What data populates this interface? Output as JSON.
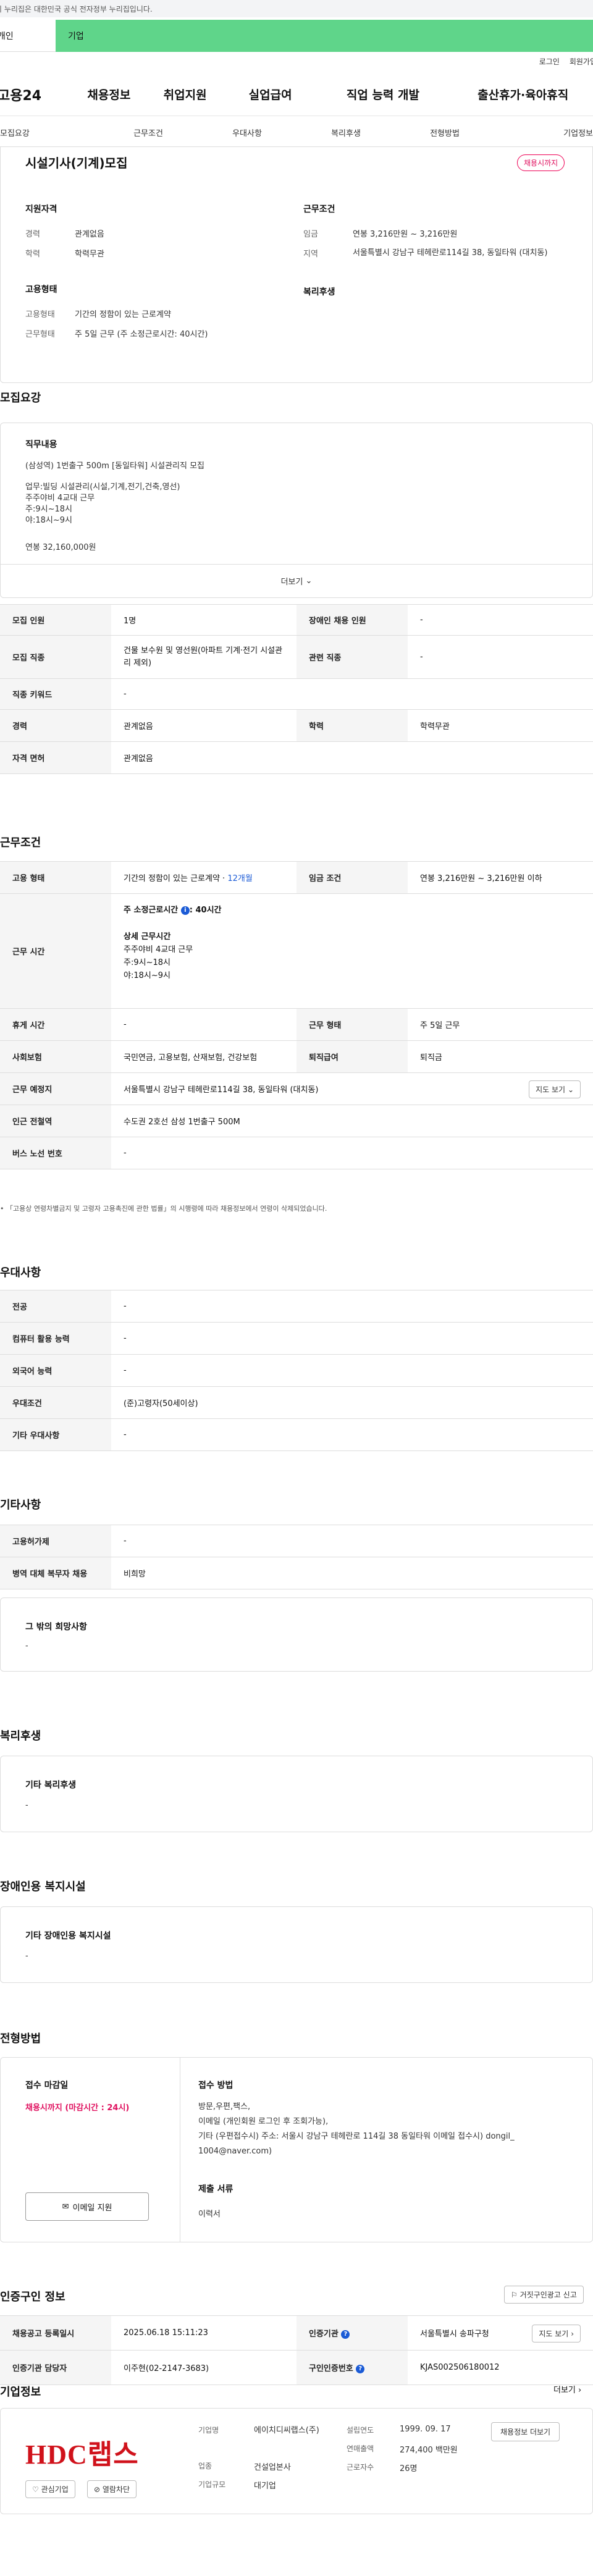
{
  "gov_bar": "이 누리집은 대한민국 공식 전자정부 누리집입니다.",
  "user_tabs": {
    "person": "개인",
    "corp": "기업"
  },
  "util": {
    "login": "로그인",
    "join": "회원가입"
  },
  "gnb": {
    "logo": "고용24",
    "menus": [
      "채용정보",
      "취업지원",
      "실업급여",
      "직업 능력 개발",
      "출산휴가·육아휴직"
    ]
  },
  "subtabs": [
    "모집요강",
    "근무조건",
    "우대사항",
    "복리후생",
    "전형방법",
    "기업정보"
  ],
  "summary": {
    "title": "시설기사(기계)모집",
    "deadline_badge": "채용시까지",
    "qual_title": "지원자격",
    "career_label": "경력",
    "career_value": "관계없음",
    "edu_label": "학력",
    "edu_value": "학력무관",
    "cond_title": "근무조건",
    "wage_label": "임금",
    "wage_value": "연봉 3,216만원 ~ 3,216만원",
    "region_label": "지역",
    "region_value": "서울특별시 강남구 테헤란로114길 38, 동일타워 (대치동)",
    "emp_title": "고용형태",
    "emptype_label": "고용형태",
    "emptype_value": "기간의 정함이 있는 근로계약",
    "worktype_label": "근무형태",
    "worktype_value": "주 5일 근무 (주 소정근로시간: 40시간)",
    "welfare_title": "복리후생"
  },
  "recruit": {
    "title": "모집요강",
    "duty_title": "직무내용",
    "duty_lines": [
      "(삼성역) 1번출구 500m [동일타워] 시설관리직 모집",
      "업무:빌딩 시설관리(시설,기계,전기,건축,영선)",
      "주주야비 4교대 근무",
      "주:9시~18시",
      "야:18시~9시",
      "연봉 32,160,000원"
    ],
    "more": "더보기",
    "rows": {
      "count_label": "모집 인원",
      "count": "1명",
      "disabled_label": "장애인 채용 인원",
      "disabled": "-",
      "job_label": "모집 직종",
      "job": "건물 보수원 및 영선원(아파트 기계·전기 시설관리 제외)",
      "related_label": "관련 직종",
      "related": "-",
      "keyword_label": "직종 키워드",
      "keyword": "-",
      "career_label": "경력",
      "career": "관계없음",
      "edu_label": "학력",
      "edu": "학력무관",
      "license_label": "자격 면허",
      "license": "관계없음"
    }
  },
  "conditions": {
    "title": "근무조건",
    "emp_label": "고용 형태",
    "emp_value": "기간의 정함이 있는 근로계약 · ",
    "emp_months": "12개월",
    "wage_label": "임금 조건",
    "wage_value": "연봉 3,216만원 ~ 3,216만원 이하",
    "hours_label": "근무 시간",
    "hours_head": "주 소정근로시간",
    "hours_head_value": ": 40시간",
    "detail_title": "상세 근무시간",
    "detail_lines": [
      "주주야비 4교대 근무",
      "주:9시~18시",
      "야:18시~9시"
    ],
    "rest_label": "휴게 시간",
    "rest": "-",
    "form_label": "근무 형태",
    "form": "주 5일 근무",
    "insurance_label": "사회보험",
    "insurance": "국민연금, 고용보험, 산재보험, 건강보험",
    "retire_label": "퇴직급여",
    "retire": "퇴직금",
    "place_label": "근무 예정지",
    "place": "서울특별시 강남구 테헤란로114길 38, 동일타워 (대치동)",
    "map_btn": "지도 보기",
    "subway_label": "인근 전철역",
    "subway": "수도권 2호선 삼성 1번출구 500M",
    "bus_label": "버스 노선 번호",
    "bus": "-",
    "note": "「고용상 연령차별금지 및 고령자 고용촉진에 관한 법률」의 시행령에 따라 채용정보에서 연령이 삭제되었습니다."
  },
  "pref": {
    "title": "우대사항",
    "major_label": "전공",
    "major": "-",
    "pc_label": "컴퓨터 활용 능력",
    "pc": "-",
    "lang_label": "외국어 능력",
    "lang": "-",
    "cond_label": "우대조건",
    "cond": "(준)고령자(50세이상)",
    "etc_label": "기타 우대사항",
    "etc": "-"
  },
  "other": {
    "title": "기타사항",
    "permit_label": "고용허가제",
    "permit": "-",
    "military_label": "병역 대체 복무자 채용",
    "military": "비희망",
    "wish_title": "그 밖의 희망사항",
    "wish": "-"
  },
  "welfare": {
    "title": "복리후생",
    "box_title": "기타 복리후생",
    "box_value": "-"
  },
  "disability": {
    "title": "장애인용 복지시설",
    "box_title": "기타 장애인용 복지시설",
    "box_value": "-"
  },
  "selection": {
    "title": "전형방법",
    "deadline_title": "접수 마감일",
    "deadline_value": "채용시까지 (마감시간 : 24시)",
    "email_btn": "이메일 지원",
    "method_title": "접수 방법",
    "method_lines": [
      "방문,우편,팩스,",
      "이메일 (개인회원 로그인 후 조회가능),",
      "기타 (우편접수시) 주소: 서울시 강남구 테헤란로 114길 38 동일타워   이메일 접수시) dongil_",
      "1004@naver.com)"
    ],
    "docs_title": "제출 서류",
    "docs_value": "이력서"
  },
  "cert": {
    "title": "인증구인 정보",
    "report_btn": "거짓구인광고 신고",
    "reg_label": "채용공고 등록일시",
    "reg": "2025.06.18 15:11:23",
    "org_label": "인증기관",
    "org": "서울특별시 송파구청",
    "map_btn": "지도 보기",
    "staff_label": "인증기관 담당자",
    "staff": "이주현(02-2147-3683)",
    "num_label": "구인인증번호",
    "num": "KJAS002506180012"
  },
  "company": {
    "title": "기업정보",
    "more": "더보기",
    "logo": "HDC랩스",
    "fav_btn": "관심기업",
    "block_btn": "열람차단",
    "name_label": "기업명",
    "name": "에이치디씨랩스(주)",
    "industry_label": "업종",
    "industry": "건설업본사",
    "size_label": "기업규모",
    "size": "대기업",
    "year_label": "설립연도",
    "year": "1999. 09. 17",
    "sales_label": "연매출액",
    "sales": "274,400 백만원",
    "staff_label": "근로자수",
    "staff": "26명",
    "jobs_btn": "채용정보 더보기"
  }
}
